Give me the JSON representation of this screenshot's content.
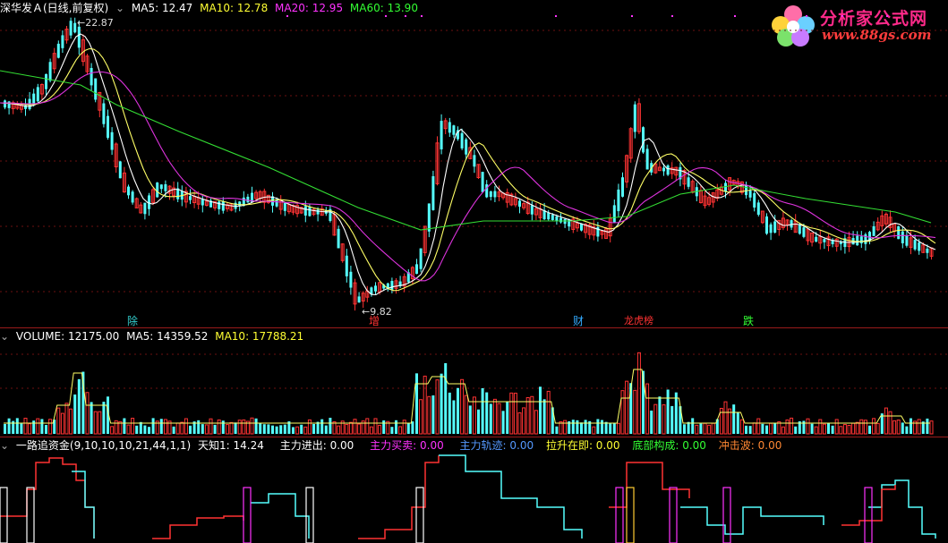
{
  "main": {
    "title": "深华发Ａ(日线,前复权)",
    "ma": [
      {
        "label": "MA5: 12.47",
        "color": "#ffffff"
      },
      {
        "label": "MA10: 12.78",
        "color": "#ffff33"
      },
      {
        "label": "MA20: 12.95",
        "color": "#ff33ff"
      },
      {
        "label": "MA60: 13.90",
        "color": "#33ff33"
      }
    ],
    "high_label": "22.87",
    "low_label": "9.82",
    "events": [
      {
        "text": "除",
        "color": "#33cccc"
      },
      {
        "text": "增",
        "color": "#ff3333"
      },
      {
        "text": "财",
        "color": "#33aaff"
      },
      {
        "text": "龙虎榜",
        "color": "#ff3333"
      },
      {
        "text": "跌",
        "color": "#33ff33"
      }
    ]
  },
  "volume": {
    "label": "VOLUME: 12175.00",
    "ma5": "MA5: 14359.52",
    "ma10": "MA10: 17788.21"
  },
  "indicator": {
    "name": "一路追资金(9,10,10,10,21,44,1,1)",
    "items": [
      {
        "label": "天知1: 14.24",
        "color": "#ffffff"
      },
      {
        "label": "主力进出: 0.00",
        "color": "#ffffff"
      },
      {
        "label": "主力买卖: 0.00",
        "color": "#ff33ff"
      },
      {
        "label": "主力轨迹: 0.00",
        "color": "#5599ff"
      },
      {
        "label": "拉升在即: 0.00",
        "color": "#ffff33"
      },
      {
        "label": "底部构成: 0.00",
        "color": "#33ff33"
      },
      {
        "label": "冲击波: 0.00",
        "color": "#ff8833"
      }
    ]
  },
  "logo": {
    "name": "分析家公式网",
    "url": "www.88gs.com"
  },
  "colors": {
    "up": "#ff3333",
    "down": "#55ffff",
    "ma60": "#33dd33",
    "ma20": "#dd33dd",
    "ma10": "#ffff66",
    "ma5": "#ffffff"
  }
}
